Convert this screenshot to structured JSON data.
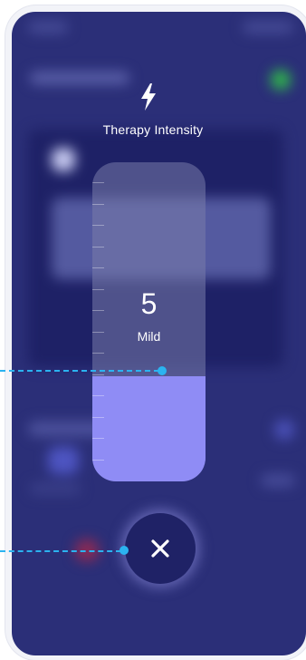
{
  "overlay": {
    "icon": "lightning-bolt-icon",
    "title": "Therapy Intensity"
  },
  "intensity": {
    "value": "5",
    "label": "Mild",
    "fill_fraction": 0.33,
    "tick_count": 14
  },
  "close_button": {
    "icon": "close-icon"
  },
  "colors": {
    "screen_background": "#2b2f78",
    "slider_fill": "#8f8cf5",
    "callout": "#2bb3f0",
    "close_button": "#1f2266"
  }
}
